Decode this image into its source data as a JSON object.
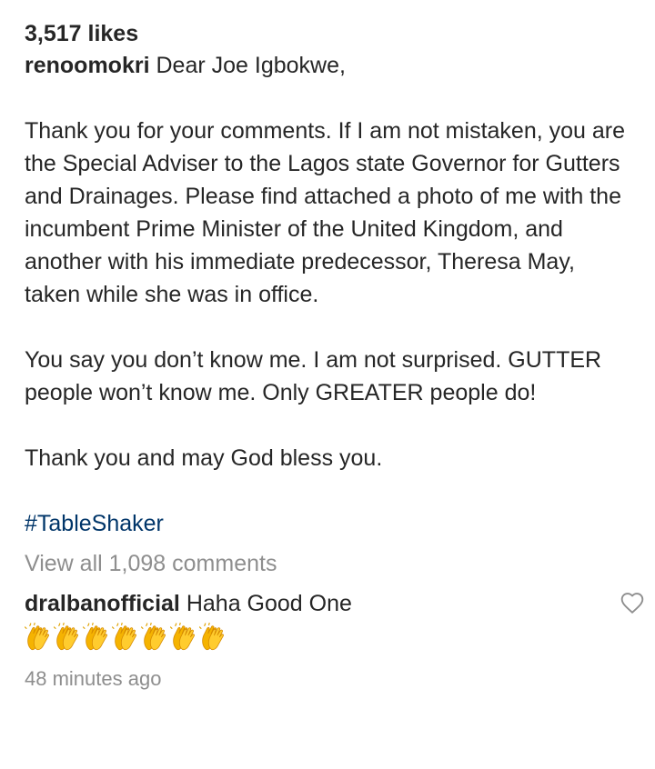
{
  "post": {
    "likes": "3,517 likes",
    "username": "renoomokri",
    "caption_first_line": "Dear Joe Igbokwe,",
    "paragraphs": [
      "Thank you for your comments. If I am not mistaken, you are the Special Adviser to the Lagos state Governor for Gutters and Drainages. Please find attached a photo of me with the incumbent Prime Minister of the United Kingdom, and another with his immediate predecessor, Theresa May, taken while she was in office.",
      "You say you don’t know me. I am not surprised. GUTTER people won’t know me. Only GREATER people do!",
      "Thank you and may God bless you."
    ],
    "hashtag": "#TableShaker",
    "view_all_comments": "View all 1,098 comments"
  },
  "comment": {
    "username": "dralbanofficial",
    "text": "Haha Good One",
    "emoji": "clapping-hands",
    "emoji_count": 7,
    "timestamp": "48 minutes ago"
  },
  "icons": {
    "like": "heart-outline-icon"
  },
  "colors": {
    "text": "#262626",
    "hashtag": "#003569",
    "muted": "#8e8e8e"
  }
}
